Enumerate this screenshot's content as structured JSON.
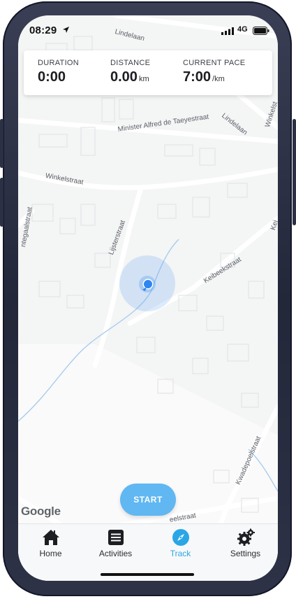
{
  "status_bar": {
    "time": "08:29",
    "network": "4G"
  },
  "stats": {
    "duration": {
      "label": "DURATION",
      "value": "0:00"
    },
    "distance": {
      "label": "DISTANCE",
      "value": "0.00",
      "unit": "km"
    },
    "pace": {
      "label": "CURRENT PACE",
      "value": "7:00",
      "unit": "/km"
    }
  },
  "map": {
    "streets": {
      "lindelaan_top": "Lindelaan",
      "lindelaan": "Lindelaan",
      "minister": "Minister Alfred de Taeyestraat",
      "winkelstraat": "Winkelstraat",
      "winkelstraat_right": "Winkelst",
      "lijsterstraat": "Lijsterstraat",
      "keibeekstraat": "Keibeekstraat",
      "megaalstraat": "ntegaalstraat",
      "kwadepoelstraat": "Kwadepoelstraat",
      "bottom": "eelstraat",
      "kei_right": "Kei"
    },
    "attribution": "Google"
  },
  "start_button": {
    "label": "START"
  },
  "tabs": [
    {
      "label": "Home",
      "icon": "home-icon"
    },
    {
      "label": "Activities",
      "icon": "list-icon"
    },
    {
      "label": "Track",
      "icon": "compass-icon",
      "active": true
    },
    {
      "label": "Settings",
      "icon": "gear-icon"
    }
  ],
  "colors": {
    "accent": "#2aa6e6",
    "start_button": "#60b7f2",
    "location_dot": "#2e86f0"
  }
}
